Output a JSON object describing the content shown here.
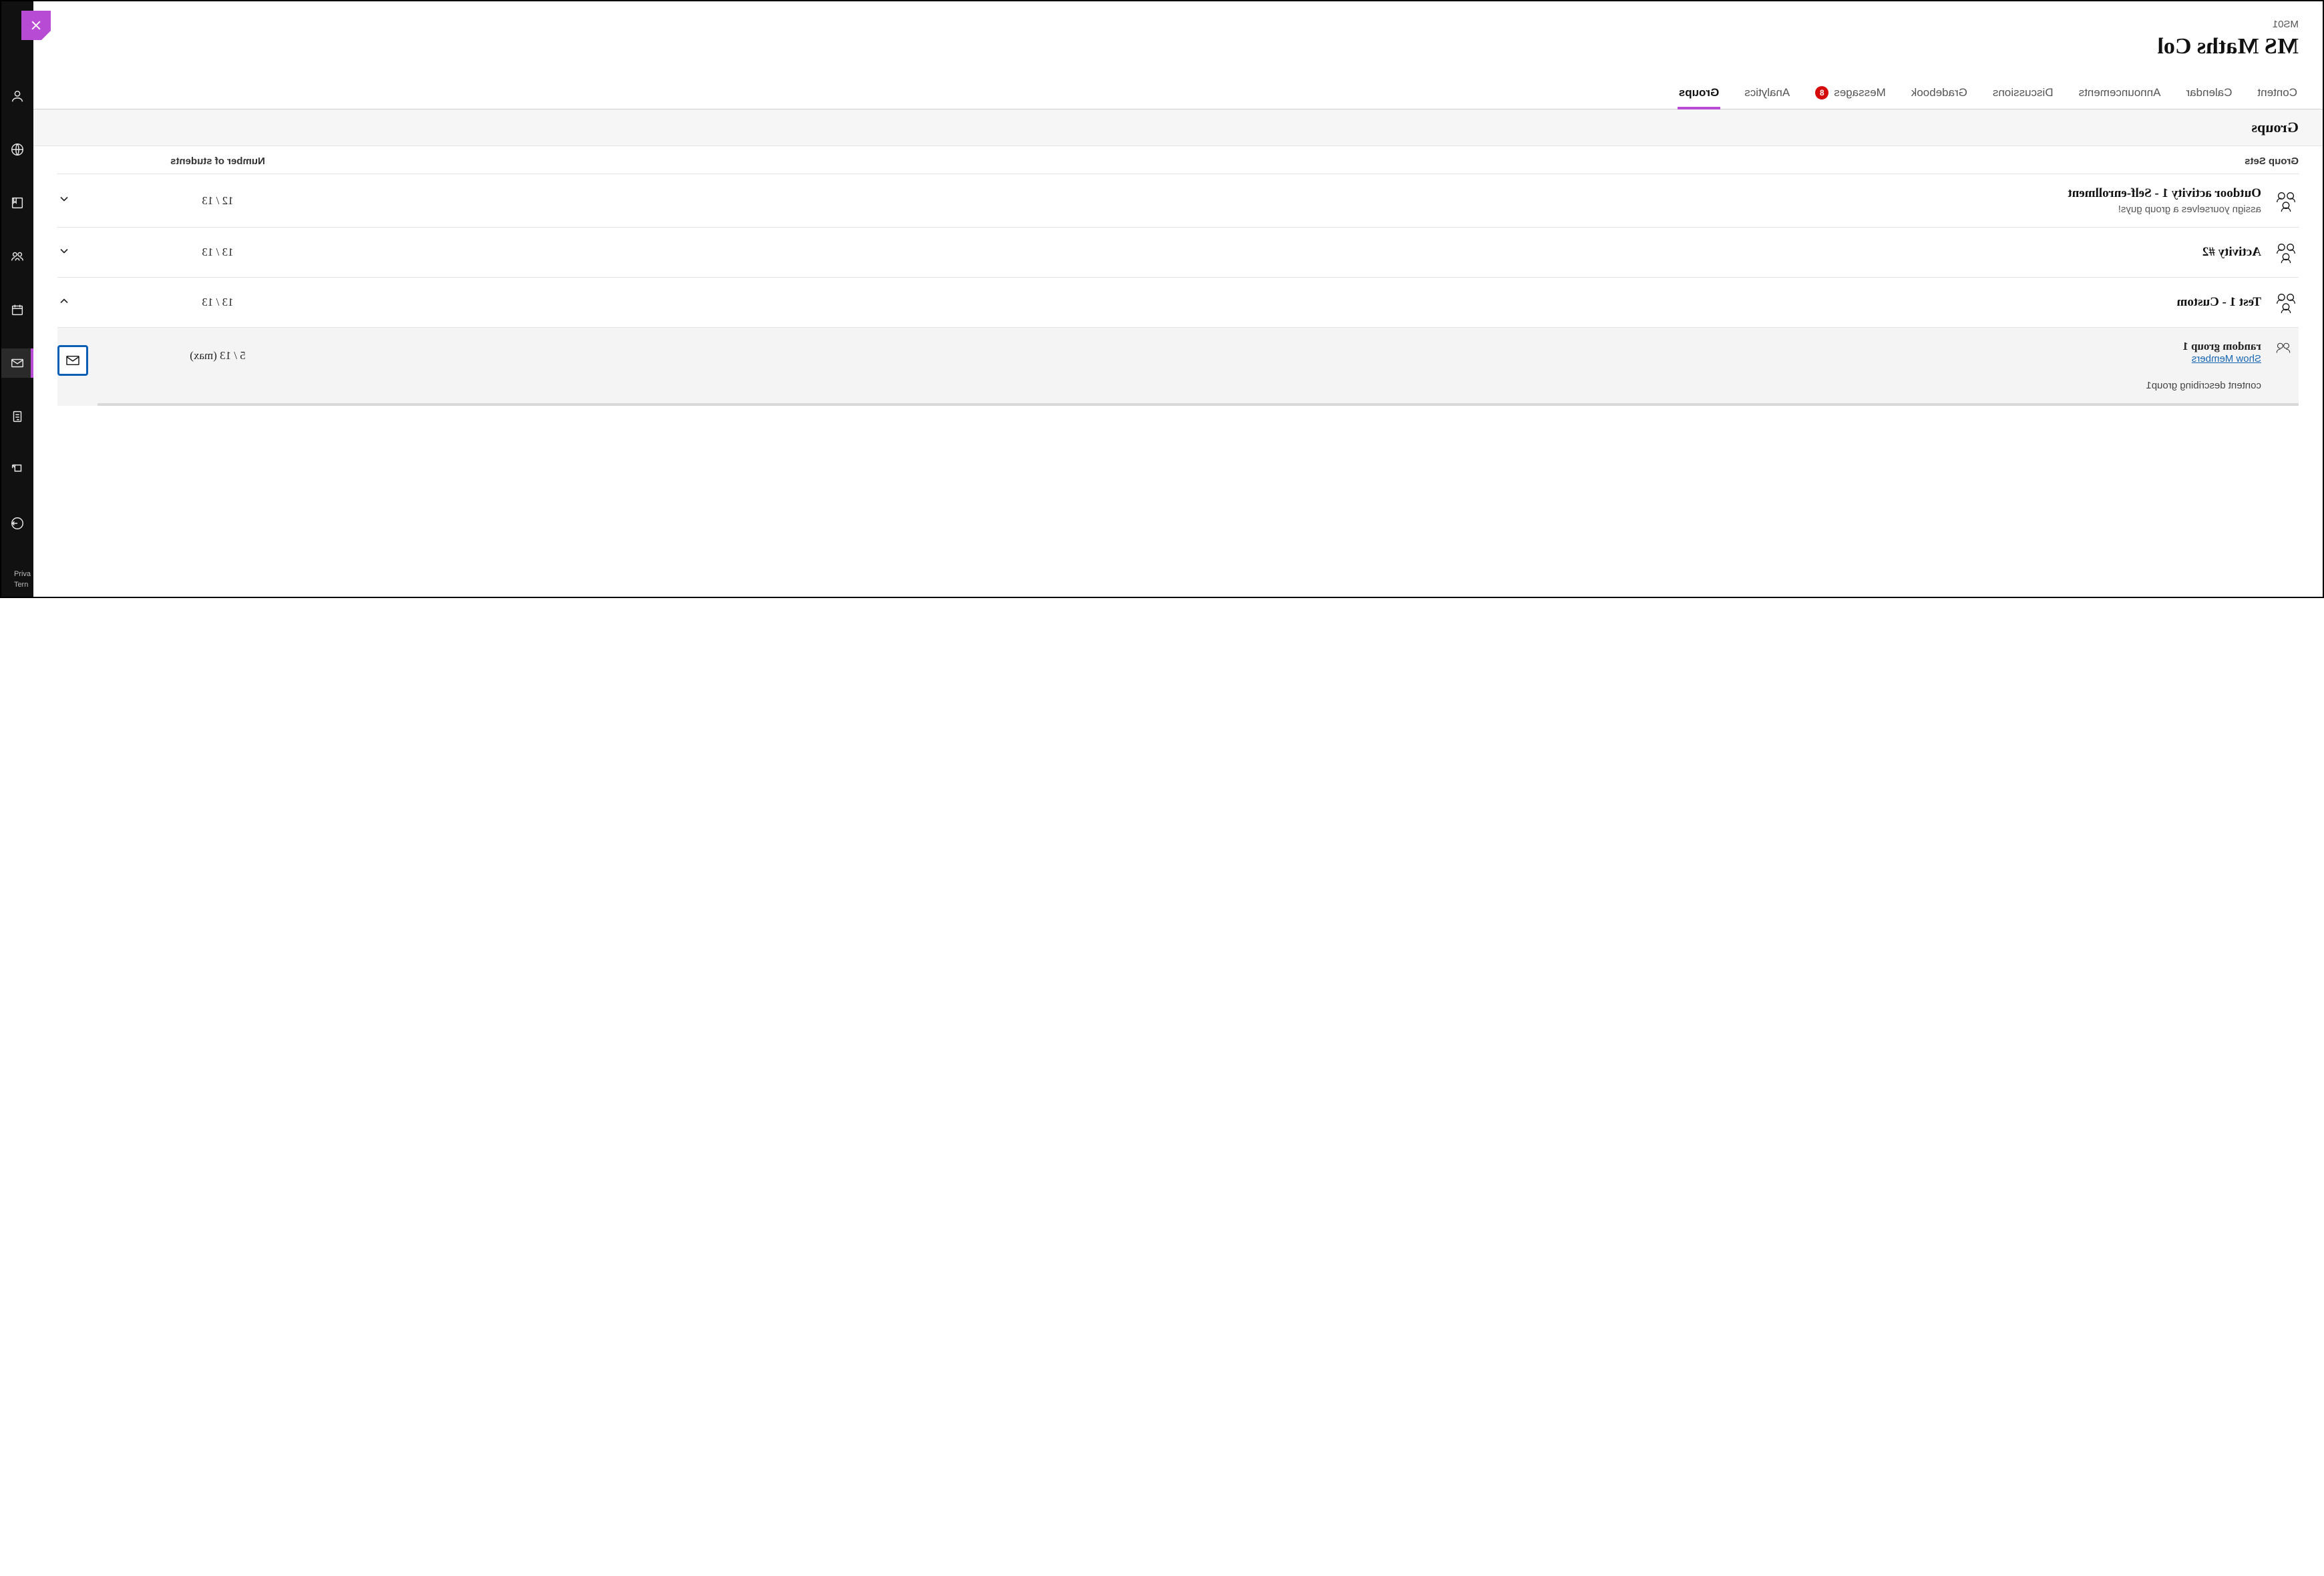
{
  "header": {
    "course_code": "MS01",
    "course_title": "MS Maths Col"
  },
  "tabs": {
    "content": "Content",
    "calendar": "Calendar",
    "announcements": "Announcements",
    "discussions": "Discussions",
    "gradebook": "Gradebook",
    "messages": "Messages",
    "messages_badge": "8",
    "analytics": "Analytics",
    "groups": "Groups",
    "active": "groups"
  },
  "section": {
    "title": "Groups"
  },
  "columns": {
    "group_sets": "Group Sets",
    "number_of_students": "Number of students"
  },
  "group_sets": [
    {
      "title": "Outdoor activity 1 - Self-enrollment",
      "subtitle": "assign yourselves a group guys!",
      "count": "12 / 13",
      "expanded": false
    },
    {
      "title": "Activity #2",
      "subtitle": "",
      "count": "13 / 13",
      "expanded": false
    },
    {
      "title": "Test 1 - Custom",
      "subtitle": "",
      "count": "13 / 13",
      "expanded": true
    }
  ],
  "expanded_group": {
    "title": "random group 1",
    "show_members": "Show Members",
    "description": "content describing group1",
    "count": "5 / 13 (max)"
  },
  "rail_footer": {
    "line1": "Priva",
    "line2": "Tern"
  }
}
